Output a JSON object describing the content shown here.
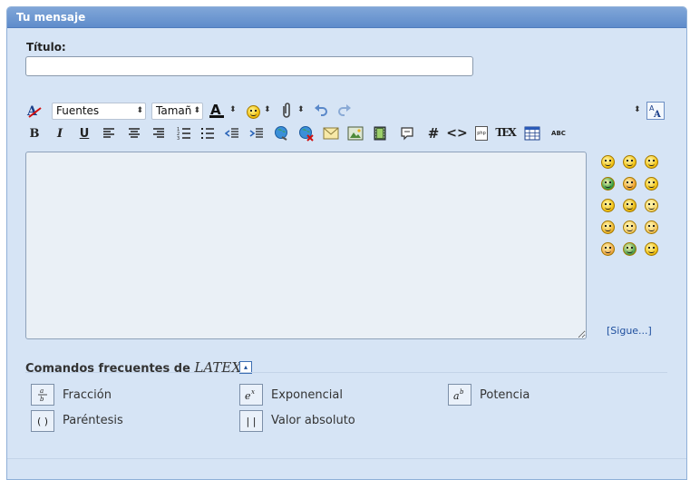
{
  "panel": {
    "title": "Tu mensaje"
  },
  "form": {
    "title_label": "Título:",
    "title_value": "",
    "title_placeholder": ""
  },
  "toolbar": {
    "font_select": "Fuentes",
    "size_select": "Tamañ",
    "row1_icons": [
      "remove-format-icon",
      "font-color-icon",
      "emoticon-icon",
      "attachment-icon",
      "undo-icon",
      "redo-icon",
      "resize-icon",
      "toggle-editor-mode-icon"
    ],
    "row2_icons": [
      "bold-icon",
      "italic-icon",
      "underline-icon",
      "align-left-icon",
      "align-center-icon",
      "align-right-icon",
      "ordered-list-icon",
      "unordered-list-icon",
      "outdent-icon",
      "indent-icon",
      "insert-link-icon",
      "remove-link-icon",
      "email-icon",
      "insert-image-icon",
      "insert-video-icon",
      "quote-icon",
      "hash-icon",
      "code-icon",
      "php-icon",
      "tex-icon",
      "table-icon",
      "spellcheck-icon"
    ],
    "bold": "B",
    "italic": "I",
    "underline": "U",
    "hash": "#",
    "code": "<>",
    "spellcheck": "ABC",
    "tex": "TEX",
    "php": "php"
  },
  "editor": {
    "value": ""
  },
  "smilies": {
    "count": 15,
    "more_link": "[Sigue...]"
  },
  "latex": {
    "heading": "Comandos frecuentes de ",
    "logo": "LATEX",
    "commands": [
      {
        "symbol": "a/b",
        "label": "Fracción"
      },
      {
        "symbol": "e^x",
        "label": "Exponencial"
      },
      {
        "symbol": "a^b",
        "label": "Potencia"
      },
      {
        "symbol": "( )",
        "label": "Paréntesis"
      },
      {
        "symbol": "| |",
        "label": "Valor absoluto"
      }
    ]
  },
  "colors": {
    "panel_bg": "#d6e4f5",
    "header_bg": "#6a94d0",
    "editor_bg": "#eaf0f6",
    "link": "#1f4f9e"
  }
}
